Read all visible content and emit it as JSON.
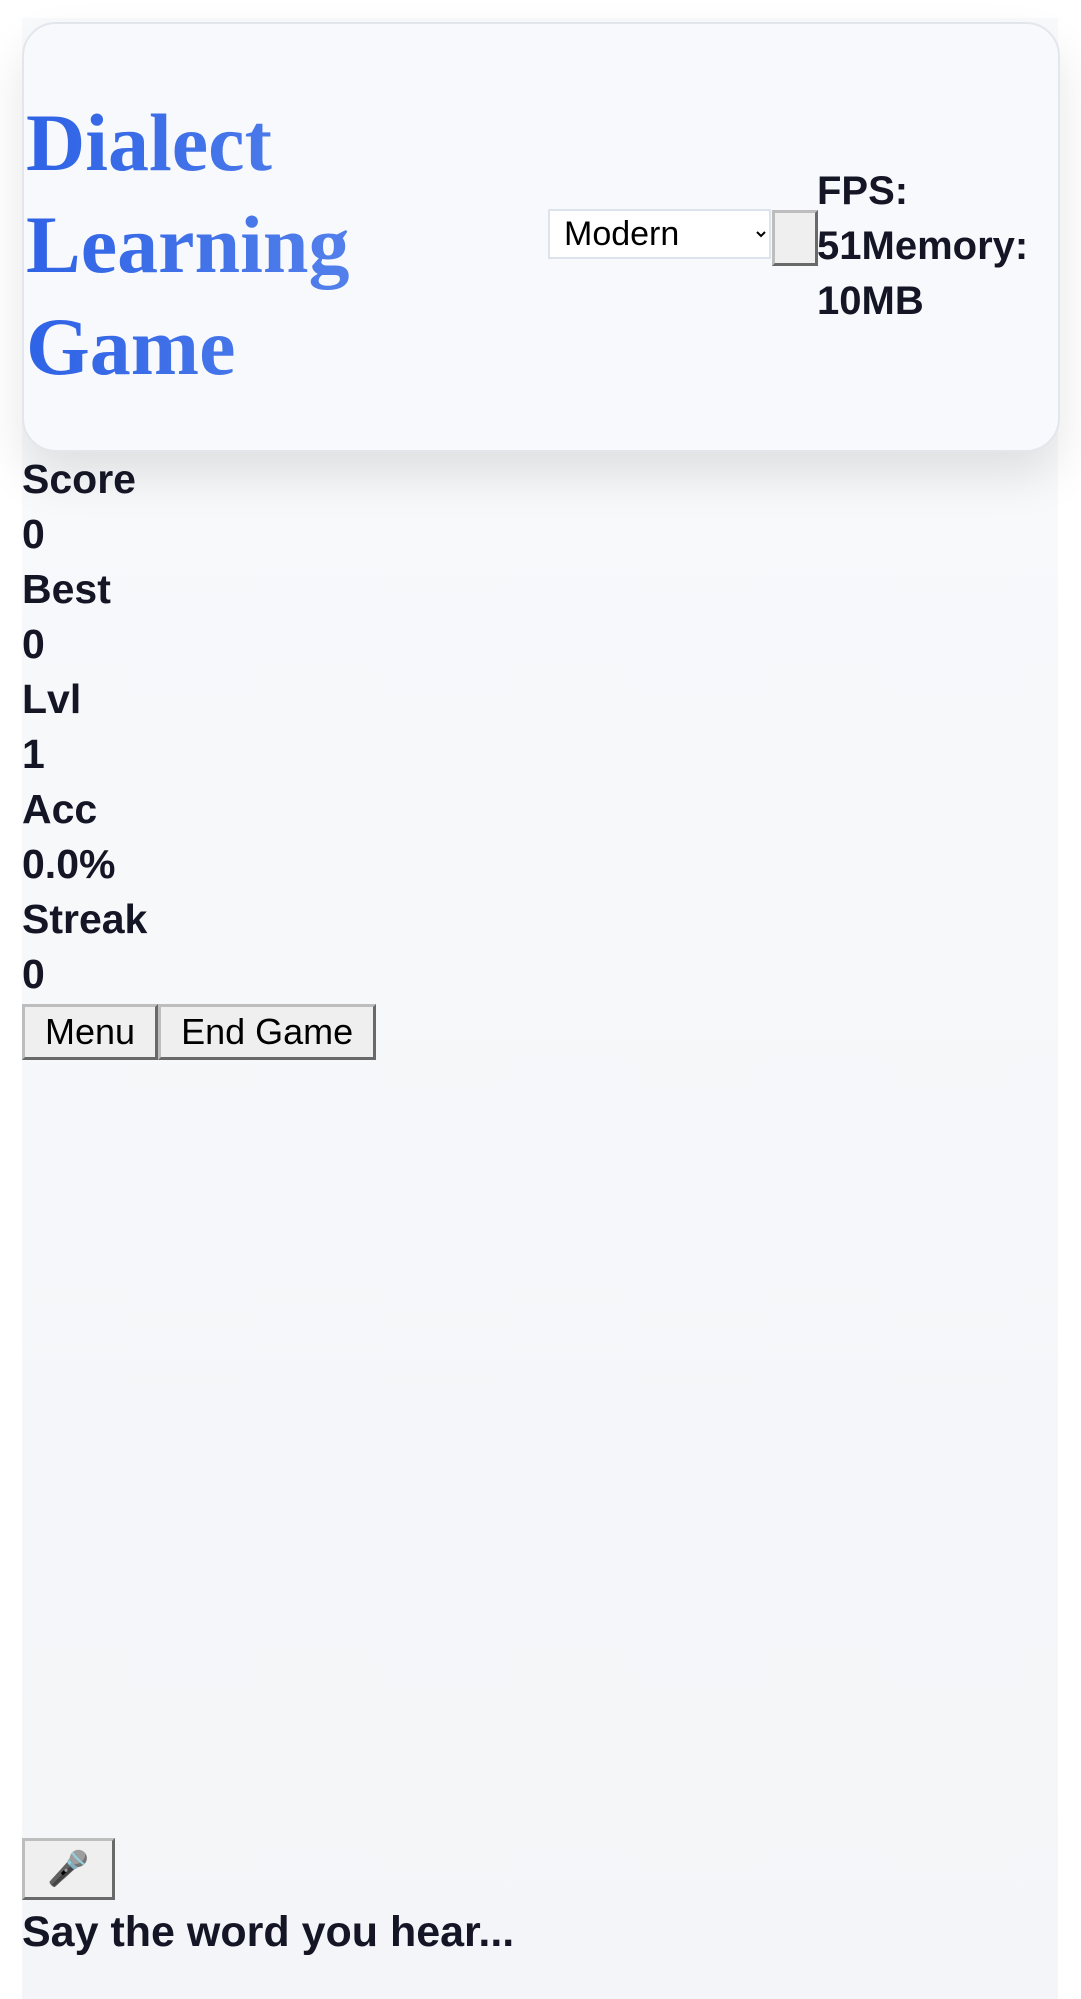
{
  "header": {
    "title": "Dialect Learning Game",
    "mode_select": {
      "selected": "Modern",
      "options": [
        "Modern"
      ]
    },
    "fps_label": "FPS:",
    "fps_value": "51",
    "memory_label": "Memory:",
    "memory_value": "10MB"
  },
  "stats": [
    {
      "label": "Score",
      "value": "0"
    },
    {
      "label": "Best",
      "value": "0"
    },
    {
      "label": "Lvl",
      "value": "1"
    },
    {
      "label": "Acc",
      "value": "0.0%"
    },
    {
      "label": "Streak",
      "value": "0"
    }
  ],
  "controls": {
    "menu_label": "Menu",
    "end_game_label": "End Game"
  },
  "microphone": {
    "icon": "microphone-icon",
    "glyph": "🎤"
  },
  "prompt": "Say the word you hear..."
}
